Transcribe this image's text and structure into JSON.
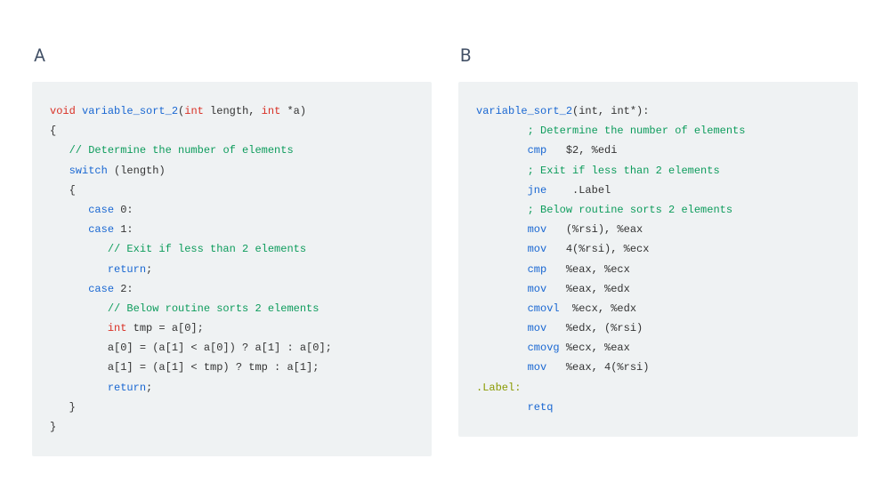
{
  "panels": {
    "left": {
      "label": "A"
    },
    "right": {
      "label": "B"
    }
  },
  "c_code": {
    "ret_kw": "void",
    "fn_name": "variable_sort_2",
    "sig_open": "(",
    "int_kw_1": "int",
    "param_len": " length, ",
    "int_kw_2": "int",
    "param_a": " *a)",
    "brace_open": "{",
    "cmt_num_elems": "// Determine the number of elements",
    "switch_kw": "switch",
    "switch_arg": " (length)",
    "brace2_open": "{",
    "case0_kw": "case",
    "case0_rest": " 0:",
    "case1_kw": "case",
    "case1_rest": " 1:",
    "cmt_exit": "// Exit if less than 2 elements",
    "return1_kw": "return",
    "return1_semi": ";",
    "case2_kw": "case",
    "case2_rest": " 2:",
    "cmt_sort2": "// Below routine sorts 2 elements",
    "int_tmp_kw": "int",
    "tmp_decl_rest": " tmp = a[0];",
    "line_a0": "a[0] = (a[1] < a[0]) ? a[1] : a[0];",
    "line_a1": "a[1] = (a[1] < tmp) ? tmp : a[1];",
    "return2_kw": "return",
    "return2_semi": ";",
    "brace2_close": "}",
    "brace_close": "}"
  },
  "asm": {
    "fn_name": "variable_sort_2",
    "sig": "(int, int*):",
    "cmt_num_elems": "; Determine the number of elements",
    "op_cmp1": "cmp",
    "arg_cmp1": "   $2, %edi",
    "cmt_exit": "; Exit if less than 2 elements",
    "op_jne": "jne",
    "arg_jne": "    .Label",
    "cmt_sort2": "; Below routine sorts 2 elements",
    "op_mov1": "mov",
    "arg_mov1": "   (%rsi), %eax",
    "op_mov2": "mov",
    "arg_mov2": "   4(%rsi), %ecx",
    "op_cmp2": "cmp",
    "arg_cmp2": "   %eax, %ecx",
    "op_mov3": "mov",
    "arg_mov3": "   %eax, %edx",
    "op_cmovl": "cmovl",
    "arg_cmovl": "  %ecx, %edx",
    "op_mov4": "mov",
    "arg_mov4": "   %edx, (%rsi)",
    "op_cmovg": "cmovg",
    "arg_cmovg": " %ecx, %eax",
    "op_mov5": "mov",
    "arg_mov5": "   %eax, 4(%rsi)",
    "label": ".Label:",
    "op_retq": "retq"
  }
}
